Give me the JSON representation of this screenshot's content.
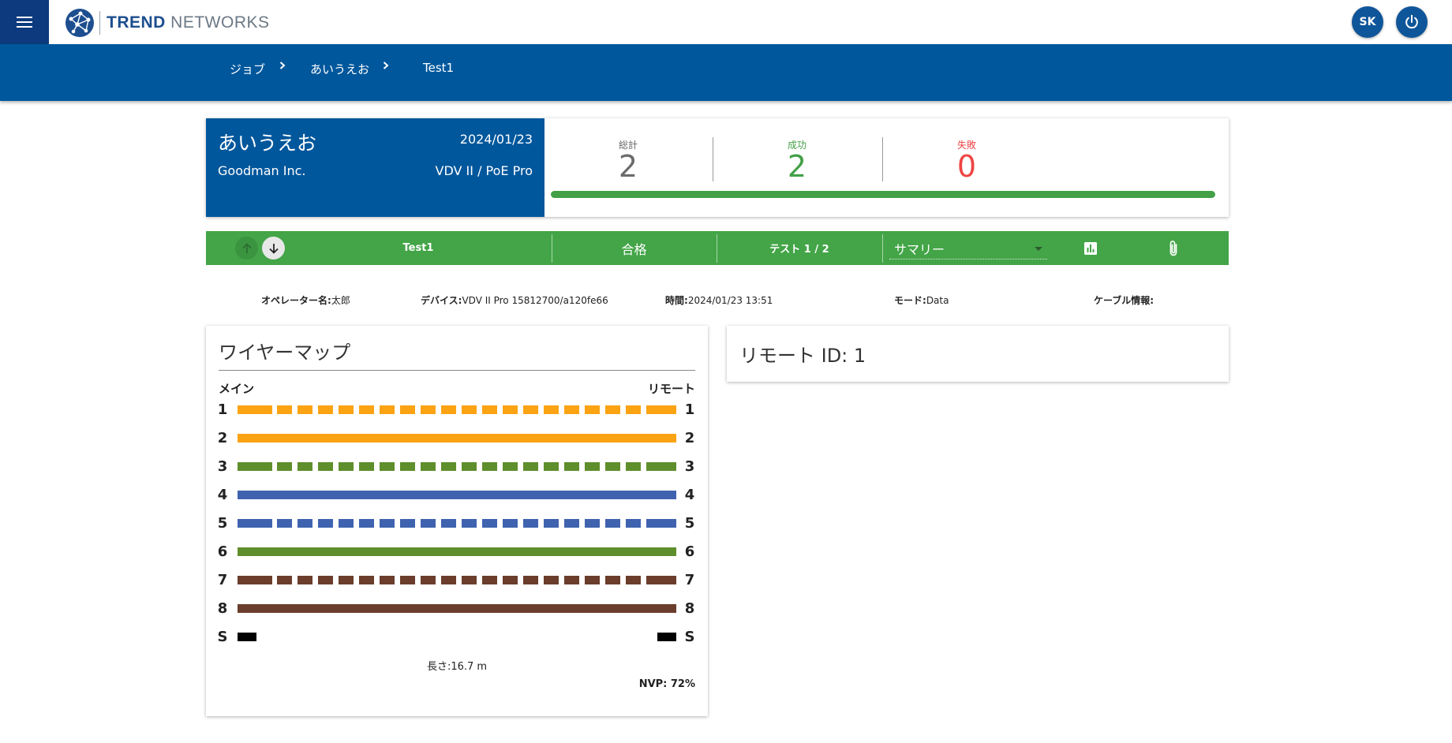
{
  "header": {
    "brand_bold": "TREND",
    "brand_light": " NETWORKS",
    "user_initials": "SK",
    "menu_icon": "hamburger-icon",
    "power_icon": "power-icon"
  },
  "breadcrumb": [
    "ジョブ",
    "あいうえお",
    "Test1"
  ],
  "job": {
    "name": "あいうえお",
    "date": "2024/01/23",
    "company": "Goodman Inc.",
    "device": "VDV II / PoE Pro"
  },
  "stats": {
    "total_label": "総計",
    "total": "2",
    "pass_label": "成功",
    "pass": "2",
    "fail_label": "失敗",
    "fail": "0",
    "progress_pass_fraction": 1.0
  },
  "testbar": {
    "test_name": "Test1",
    "result": "合格",
    "test_index": "テスト 1 / 2",
    "view_select": "サマリー",
    "chart_icon": "bar-chart-icon",
    "attach_icon": "paperclip-icon"
  },
  "info": {
    "operator_label": "オペレーター名:",
    "operator": "太郎",
    "device_label": "デバイス:",
    "device": "VDV II Pro 15812700/a120fe66",
    "time_label": "時間:",
    "time": "2024/01/23 13:51",
    "mode_label": "モード:",
    "mode": "Data",
    "cable_label": "ケーブル情報:",
    "cable": ""
  },
  "wiremap": {
    "title": "ワイヤーマップ",
    "main_label": "メイン",
    "remote_label": "リモート",
    "wires": [
      {
        "pin": "1",
        "color": "#fba313",
        "style": "dashed"
      },
      {
        "pin": "2",
        "color": "#fba313",
        "style": "solid"
      },
      {
        "pin": "3",
        "color": "#5f8e2c",
        "style": "dashed"
      },
      {
        "pin": "4",
        "color": "#3f63af",
        "style": "solid"
      },
      {
        "pin": "5",
        "color": "#3f63af",
        "style": "dashed"
      },
      {
        "pin": "6",
        "color": "#5f8e2c",
        "style": "solid"
      },
      {
        "pin": "7",
        "color": "#6b3d2c",
        "style": "dashed"
      },
      {
        "pin": "8",
        "color": "#6b3d2c",
        "style": "solid"
      },
      {
        "pin": "S",
        "color": "#000000",
        "style": "shield"
      }
    ],
    "length": "長さ:16.7 m",
    "nvp": "NVP: 72%"
  },
  "remote": {
    "title": "リモート ID: 1"
  }
}
